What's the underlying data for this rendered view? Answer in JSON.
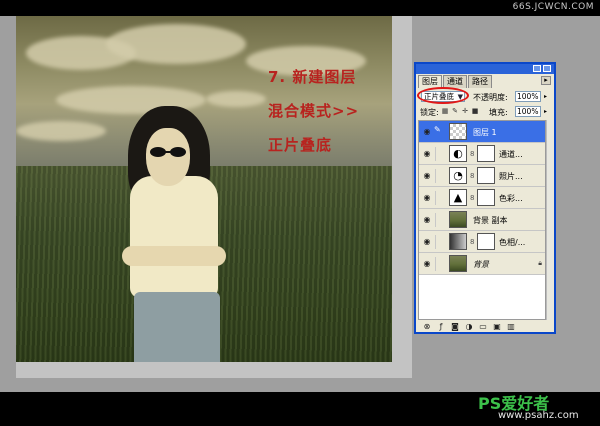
{
  "watermark_top": "66S.JCWCN.COM",
  "overlay_text": {
    "line1": "7. 新建图层",
    "line2": "混合模式>>",
    "line3": "正片叠底"
  },
  "layers_panel": {
    "tabs": [
      "图层",
      "通道",
      "路径"
    ],
    "active_tab": "图层",
    "blend_mode": "正片叠底",
    "opacity_label": "不透明度:",
    "opacity_value": "100%",
    "lock_label": "锁定:",
    "fill_label": "填充:",
    "fill_value": "100%",
    "layers": [
      {
        "name": "图层 1",
        "thumb": "transparent",
        "selected": true,
        "has_mask": false
      },
      {
        "name": "通道...",
        "thumb": "adjustment-channel-mixer",
        "selected": false,
        "has_mask": true
      },
      {
        "name": "照片...",
        "thumb": "adjustment-photo-filter",
        "selected": false,
        "has_mask": true
      },
      {
        "name": "色彩...",
        "thumb": "adjustment-color-balance",
        "selected": false,
        "has_mask": true
      },
      {
        "name": "背景 副本",
        "thumb": "photo",
        "selected": false,
        "has_mask": false
      },
      {
        "name": "色相/...",
        "thumb": "adjustment-hue-saturation",
        "selected": false,
        "has_mask": true
      },
      {
        "name": "背景",
        "thumb": "photo",
        "selected": false,
        "has_mask": false,
        "locked": true
      }
    ]
  },
  "brand": {
    "logo": "PS爱好者",
    "url": "www.psahz.com"
  },
  "colors": {
    "overlay_text": "#b8231f",
    "highlight_ellipse": "#e01818",
    "selected_layer": "#3a6fe6",
    "panel_border": "#0a47c9",
    "brand_green": "#3cc14a"
  }
}
